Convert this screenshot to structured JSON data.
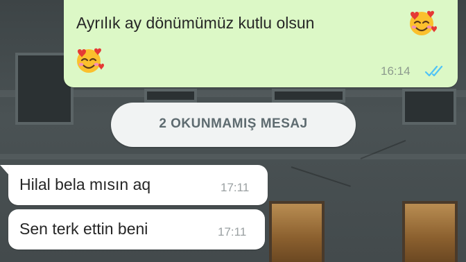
{
  "chat": {
    "outgoing": {
      "text": "Ayrılık ay dönümümüz kutlu olsun",
      "time": "16:14",
      "emoji": "smiling-face-with-hearts",
      "status": "read"
    },
    "unread_label": "2 OKUNMAMIŞ MESAJ",
    "incoming": [
      {
        "text": "Hilal bela mısın aq",
        "time": "17:11"
      },
      {
        "text": "Sen terk ettin beni",
        "time": "17:11"
      }
    ]
  },
  "colors": {
    "outgoing_bubble": "#dcf8c6",
    "incoming_bubble": "#ffffff",
    "read_ticks": "#4fc3f7",
    "unread_banner": "#f1f3f3"
  }
}
